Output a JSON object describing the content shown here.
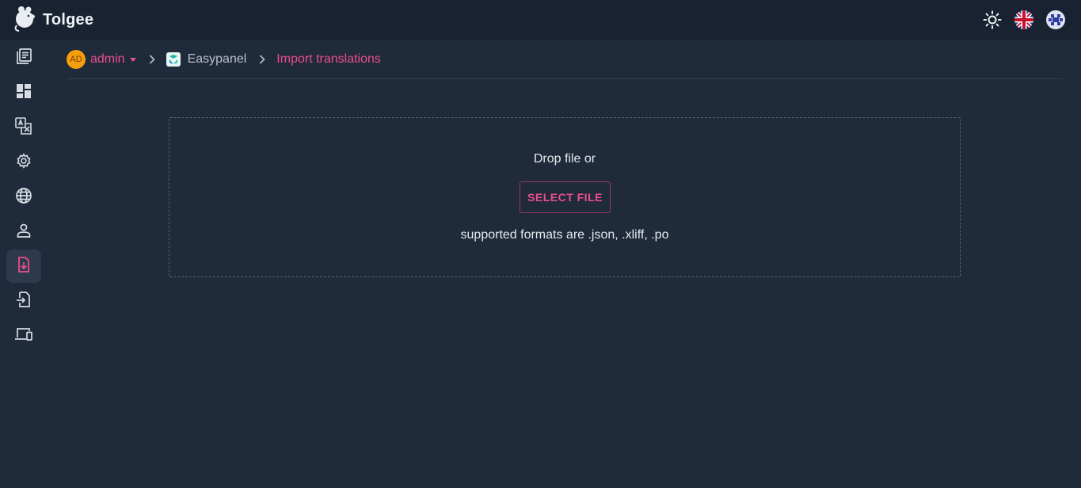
{
  "app": {
    "name": "Tolgee"
  },
  "header": {
    "icons": [
      "sun-icon",
      "uk-flag-icon",
      "user-avatar-icon"
    ]
  },
  "sidebar": {
    "items": [
      {
        "icon": "projects-list-icon",
        "active": false
      },
      {
        "icon": "dashboard-icon",
        "active": false
      },
      {
        "icon": "translations-icon",
        "active": false
      },
      {
        "icon": "settings-gear-icon",
        "active": false
      },
      {
        "icon": "languages-globe-icon",
        "active": false
      },
      {
        "icon": "members-person-icon",
        "active": false
      },
      {
        "icon": "import-file-icon",
        "active": true
      },
      {
        "icon": "export-file-icon",
        "active": false
      },
      {
        "icon": "integrate-devices-icon",
        "active": false
      }
    ]
  },
  "breadcrumb": {
    "avatar_initials": "AD",
    "owner": "admin",
    "project": "Easypanel",
    "current": "Import translations"
  },
  "dropzone": {
    "prompt": "Drop file or",
    "button_label": "SELECT FILE",
    "formats": "supported formats are .json, .xliff, .po"
  },
  "colors": {
    "accent": "#ec4f8b",
    "background": "#1f2a3b",
    "topbar": "#182230",
    "avatar": "#f59e0b"
  }
}
